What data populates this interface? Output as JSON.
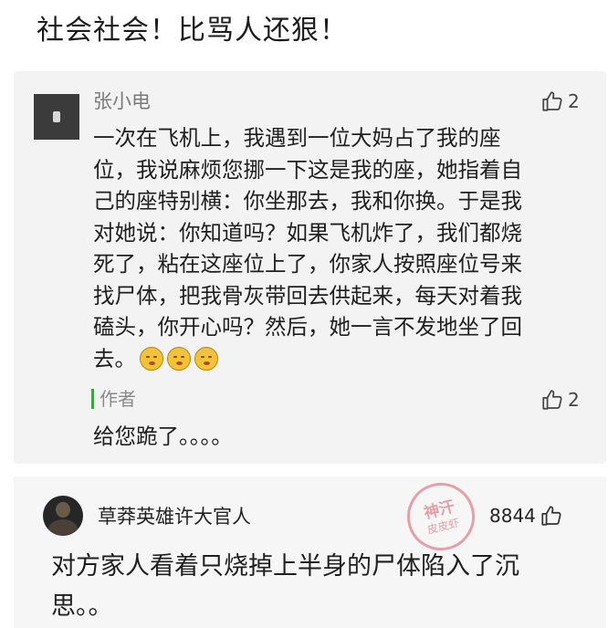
{
  "title": "社会社会！比骂人还狠！",
  "comment1": {
    "username": "张小电",
    "likes": "2",
    "lines": [
      "一次在飞机上，我遇到一位大妈占了我的座",
      "位，我说麻烦您挪一下这是我的座，她指着自",
      "己的座特别横：你坐那去，我和你换。于是我",
      "对她说：你知道吗？如果飞机炸了，我们都烧",
      "死了，粘在这座位上了，你家人按照座位号来",
      "找尸体，把我骨灰带回去供起来，每天对着我",
      "磕头，你开心吗？然后，她一言不发地坐了回",
      "去。"
    ],
    "emoji": "shushing-face-emoji",
    "emoji_count": 3,
    "author_tag": "作者",
    "reply_likes": "2",
    "reply_text": "给您跪了。。。。"
  },
  "comment2": {
    "username": "草莽英雄许大官人",
    "likes": "8844",
    "stamp_top": "神汗",
    "stamp_bottom": "皮皮虾",
    "lines": [
      "对方家人看着只烧掉上半身的尸体陷入了沉",
      "思。。"
    ]
  },
  "colors": {
    "card_bg": "#f3f3f3",
    "author_bar": "#3da346",
    "stamp": "#d65868"
  },
  "icons": {
    "like": "thumbs-up-outline-icon"
  }
}
